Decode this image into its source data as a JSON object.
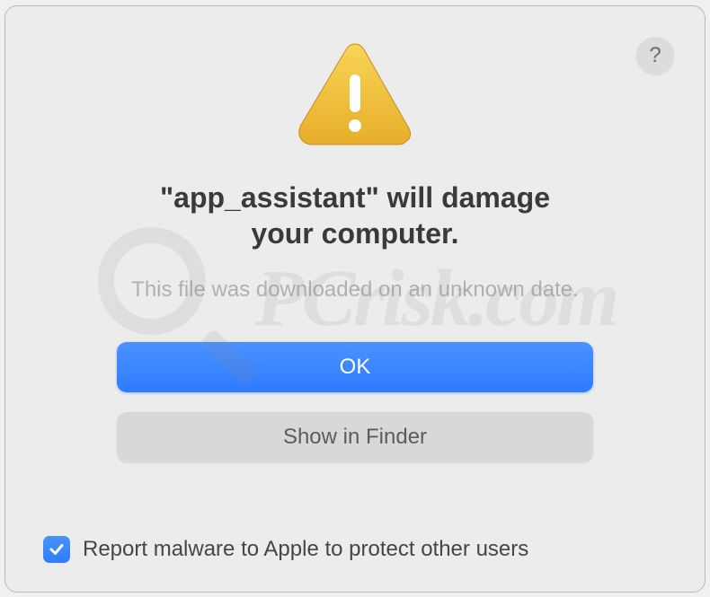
{
  "dialog": {
    "help_label": "?",
    "title_line1": "\"app_assistant\" will damage",
    "title_line2": "your computer.",
    "subtitle": "This file was downloaded on an unknown date.",
    "ok_label": "OK",
    "show_in_finder_label": "Show in Finder",
    "checkbox_label": "Report malware to Apple to protect other users",
    "checkbox_checked": true
  },
  "watermark": {
    "text": "PCrisk.com"
  }
}
